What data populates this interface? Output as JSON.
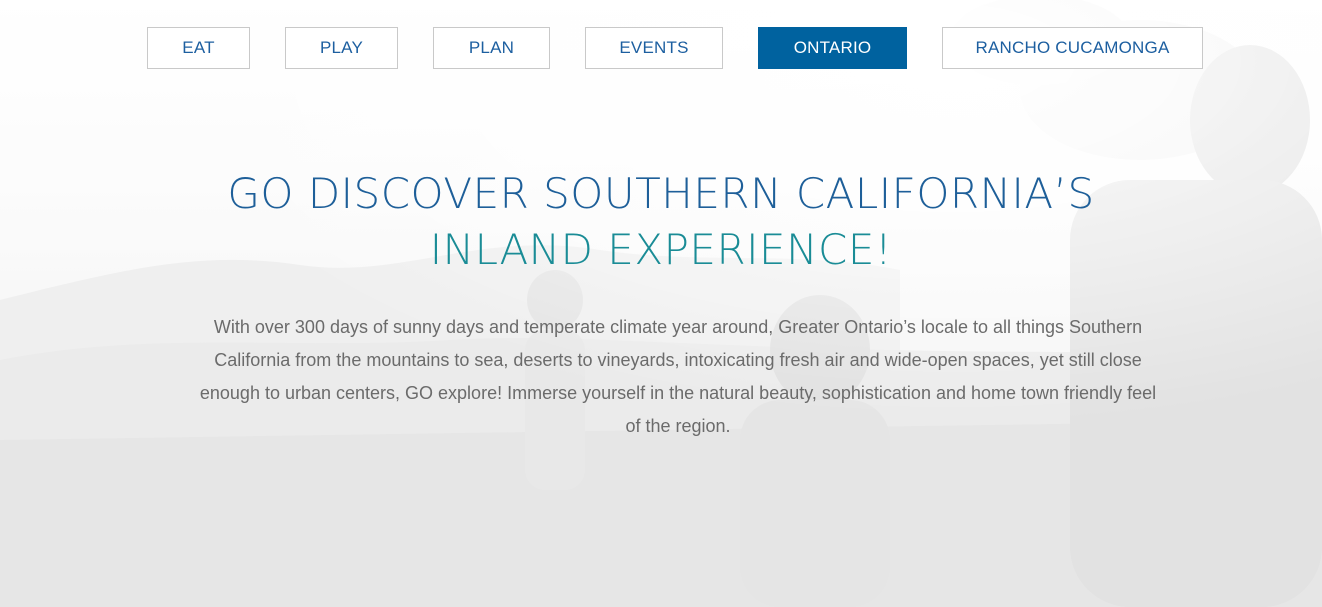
{
  "nav": {
    "items": [
      {
        "label": "EAT",
        "active": false
      },
      {
        "label": "PLAY",
        "active": false
      },
      {
        "label": "PLAN",
        "active": false
      },
      {
        "label": "EVENTS",
        "active": false
      },
      {
        "label": "ONTARIO",
        "active": true
      },
      {
        "label": "RANCHO CUCAMONGA",
        "active": false
      }
    ]
  },
  "hero": {
    "headline_line1": "GO DISCOVER SOUTHERN CALIFORNIA’S",
    "headline_line2": "INLAND EXPERIENCE!",
    "body": "With over 300 days of sunny days and temperate climate year around, Greater Ontario’s locale to all things Southern California from the mountains to sea, deserts to vineyards, intoxicating fresh air and wide-open spaces, yet still close enough to urban centers, GO explore! Immerse yourself in the natural beauty, sophistication and home town friendly feel of the region."
  },
  "colors": {
    "nav_text": "#1d5fa0",
    "nav_active_bg": "#00629f",
    "headline_blue": "#1e5f99",
    "headline_teal": "#1a8c96",
    "body_text": "#6b6b6b"
  }
}
